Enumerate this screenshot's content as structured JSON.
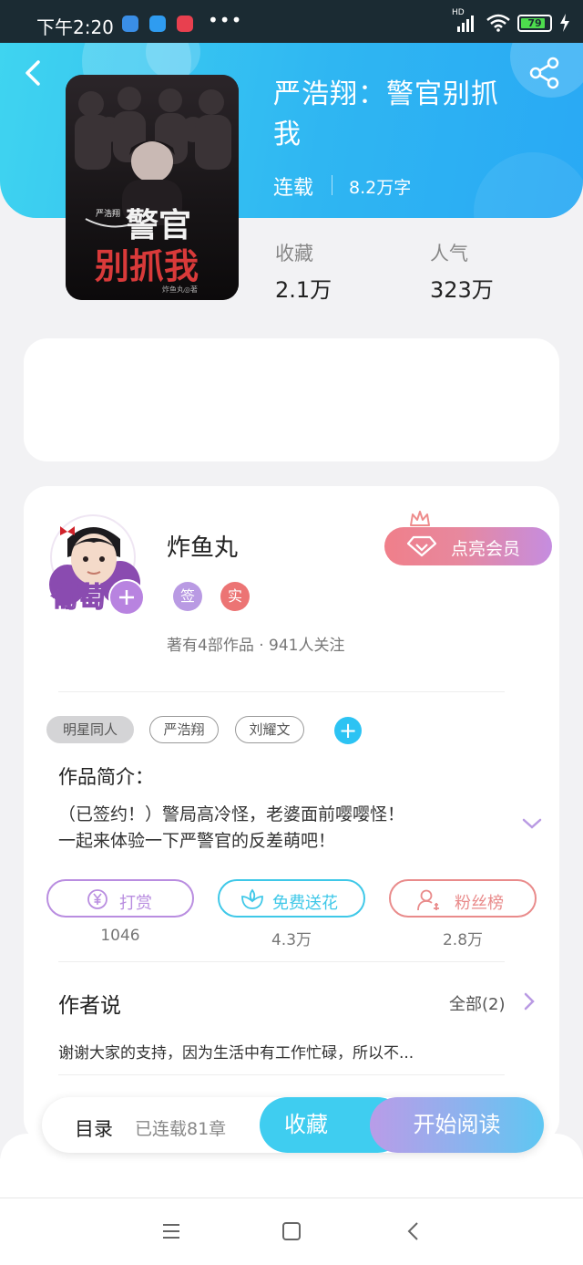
{
  "status_bar": {
    "time": "下午2:20",
    "network": "HD",
    "battery": "79",
    "more": "•••"
  },
  "book": {
    "title_line1": "严浩翔：警官别抓",
    "title_line2": "我",
    "status": "连载",
    "word_count": "8.2万字",
    "cover_title_top": "警官",
    "cover_title_bottom": "别抓我",
    "cover_subtitle": "严浩翔",
    "cover_author": "炸鱼丸◎著"
  },
  "stats": {
    "favorites_label": "收藏",
    "favorites_value": "2.1万",
    "popularity_label": "人气",
    "popularity_value": "323万"
  },
  "author": {
    "name": "炸鱼丸",
    "avatar_text": "葡萄",
    "badge_signed": "签",
    "badge_verified": "实",
    "meta": "著有4部作品 · 941人关注",
    "vip_button": "点亮会员"
  },
  "tags": [
    "明星同人",
    "严浩翔",
    "刘耀文"
  ],
  "intro": {
    "title": "作品简介：",
    "line1": "（已签约！）警局高冷怪，老婆面前嘤嘤怪！",
    "line2": "一起来体验一下严警官的反差萌吧！"
  },
  "actions": [
    {
      "label": "打赏",
      "count": "1046",
      "color": "#b98de0"
    },
    {
      "label": "免费送花",
      "count": "4.3万",
      "color": "#3fc8e8"
    },
    {
      "label": "粉丝榜",
      "count": "2.8万",
      "color": "#e98b8b"
    }
  ],
  "author_says": {
    "title": "作者说",
    "all_label": "全部(2)",
    "preview": "谢谢大家的支持，因为生活中有工作忙碌，所以不..."
  },
  "bottom_bar": {
    "toc_label": "目录",
    "chapter_count": "已连载81章",
    "collect_button": "收藏",
    "read_button": "开始阅读"
  },
  "colors": {
    "header": "#2fb6f2",
    "accent": "#2cc3f3",
    "vip_gradient_start": "#f07f8a",
    "vip_gradient_end": "#c58de0"
  }
}
